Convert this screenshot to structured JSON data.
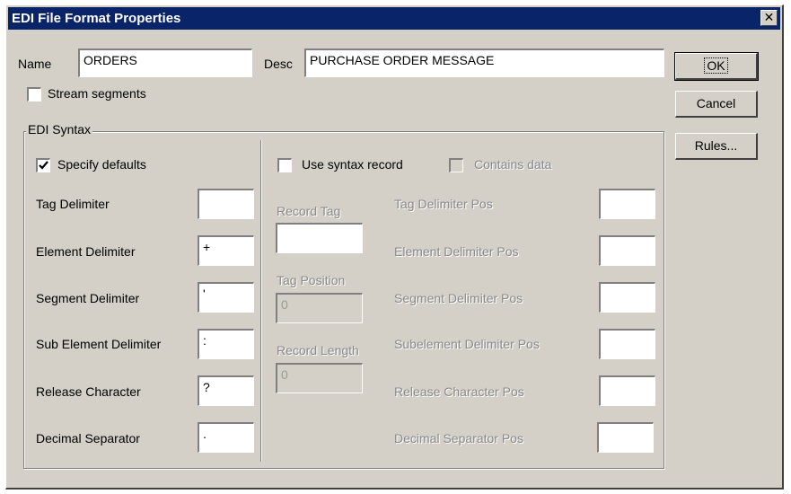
{
  "window": {
    "title": "EDI File Format Properties"
  },
  "name_field": {
    "label": "Name",
    "value": "ORDERS"
  },
  "desc_field": {
    "label": "Desc",
    "value": "PURCHASE ORDER MESSAGE"
  },
  "stream_segments": {
    "label": "Stream segments",
    "checked": false
  },
  "buttons": {
    "ok": "OK",
    "cancel": "Cancel",
    "rules": "Rules..."
  },
  "edi_syntax": {
    "group_title": "EDI Syntax",
    "specify_defaults": {
      "label": "Specify defaults",
      "checked": true
    },
    "delimiters": [
      {
        "label": "Tag Delimiter",
        "value": ""
      },
      {
        "label": "Element Delimiter",
        "value": "+"
      },
      {
        "label": "Segment Delimiter",
        "value": "'"
      },
      {
        "label": "Sub Element Delimiter",
        "value": ":"
      },
      {
        "label": "Release Character",
        "value": "?"
      },
      {
        "label": "Decimal Separator",
        "value": "."
      }
    ],
    "use_syntax_record": {
      "label": "Use syntax record",
      "checked": false
    },
    "contains_data": {
      "label": "Contains data",
      "checked": false,
      "enabled": false
    },
    "record_tag": {
      "label": "Record Tag",
      "value": ""
    },
    "tag_position": {
      "label": "Tag Position",
      "value": "0"
    },
    "record_length": {
      "label": "Record Length",
      "value": "0"
    },
    "positions": [
      {
        "label": "Tag Delimiter Pos",
        "value": ""
      },
      {
        "label": "Element Delimiter Pos",
        "value": ""
      },
      {
        "label": "Segment Delimiter Pos",
        "value": ""
      },
      {
        "label": "Subelement Delimiter Pos",
        "value": ""
      },
      {
        "label": "Release Character Pos",
        "value": ""
      },
      {
        "label": "Decimal Separator Pos",
        "value": ""
      }
    ]
  },
  "colors": {
    "titlebar": "#0a246a",
    "face": "#d4d0c8",
    "disabled_text": "#8a8a8a"
  }
}
